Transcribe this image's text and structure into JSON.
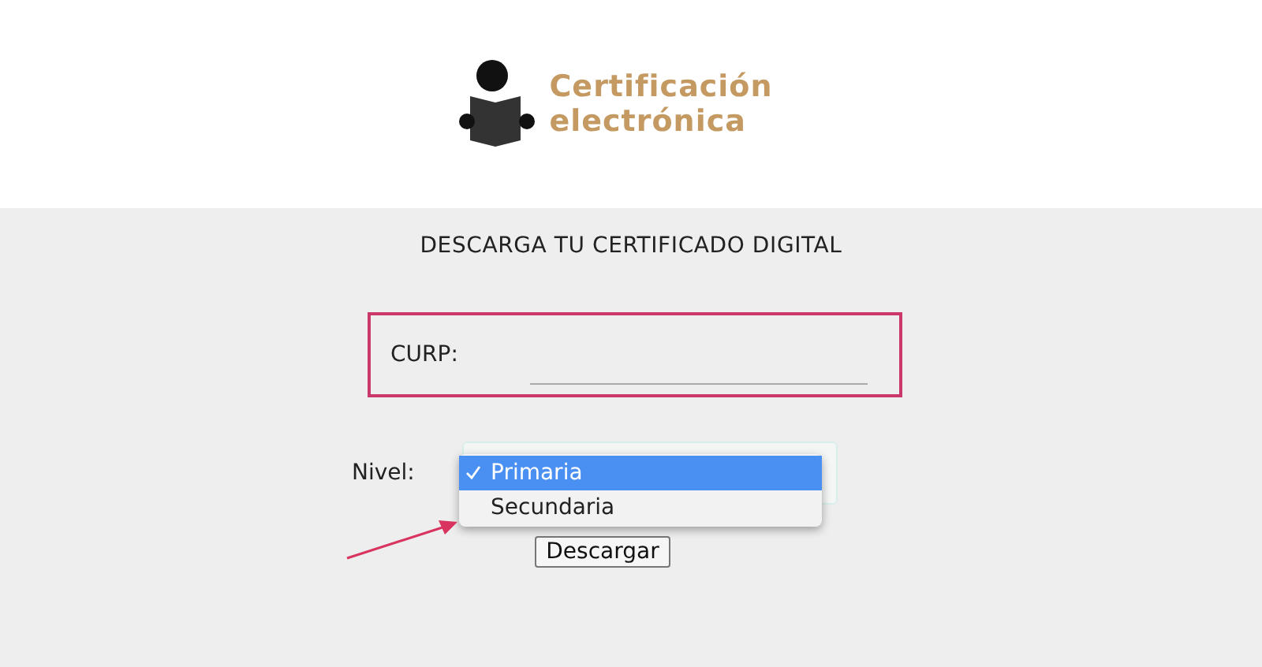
{
  "logo": {
    "lines": [
      "Certificación",
      "electrónica"
    ]
  },
  "title": "DESCARGA TU CERTIFICADO DIGITAL",
  "curp": {
    "label": "CURP:"
  },
  "nivel": {
    "label": "Nivel:",
    "expanded": true,
    "options": [
      {
        "label": "Primaria",
        "selected": true
      },
      {
        "label": "Secundaria",
        "selected": false
      }
    ]
  },
  "button": "Descargar"
}
